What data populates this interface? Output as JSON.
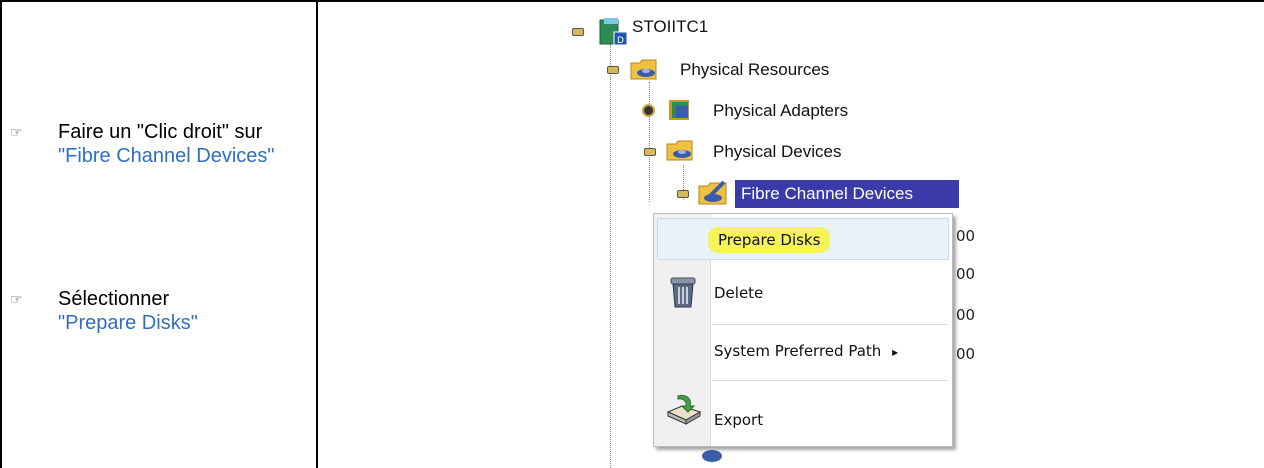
{
  "instructions": [
    {
      "pre": "Faire un \"Clic droit\" sur",
      "link": "\"Fibre Channel Devices\""
    },
    {
      "pre": "Sélectionner",
      "link": "\"Prepare Disks\""
    }
  ],
  "tree": {
    "root": "STOIITC1",
    "physical_resources": "Physical Resources",
    "physical_adapters": "Physical Adapters",
    "physical_devices": "Physical Devices",
    "fibre_channel_devices": "Fibre Channel Devices"
  },
  "context_menu": {
    "prepare_disks": "Prepare Disks",
    "delete": "Delete",
    "system_preferred_path": "System Preferred Path",
    "export": "Export"
  },
  "trailing_values": [
    "00",
    "00",
    "00",
    "00"
  ],
  "icons": {
    "hand_pointer": "☞",
    "submenu_arrow": "▸"
  },
  "colors": {
    "link_blue": "#2e6fbf",
    "selection": "#3a3aa8",
    "highlight_yellow": "#f6f35a"
  }
}
